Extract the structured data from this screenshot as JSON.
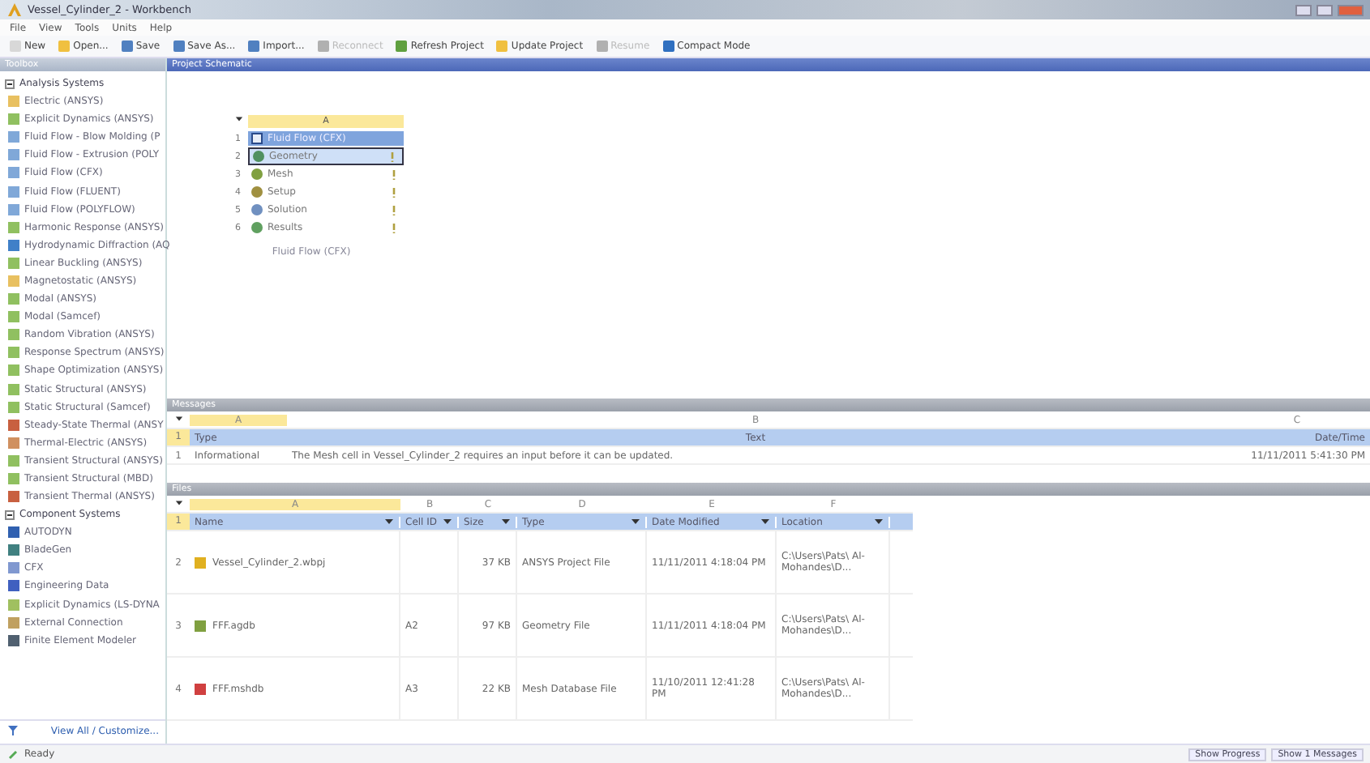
{
  "window": {
    "title": "Vessel_Cylinder_2 - Workbench"
  },
  "menu": [
    "File",
    "View",
    "Tools",
    "Units",
    "Help"
  ],
  "toolbar": [
    {
      "label": "New",
      "disabled": false,
      "color": "#d8d8d8"
    },
    {
      "label": "Open...",
      "disabled": false,
      "color": "#f0c040"
    },
    {
      "label": "Save",
      "disabled": false,
      "color": "#5080c0"
    },
    {
      "label": "Save As...",
      "disabled": false,
      "color": "#5080c0"
    },
    {
      "label": "Import...",
      "disabled": false,
      "color": "#5080c0"
    },
    {
      "label": "Reconnect",
      "disabled": true,
      "color": "#b0b0b0"
    },
    {
      "label": "Refresh Project",
      "disabled": false,
      "color": "#60a040"
    },
    {
      "label": "Update Project",
      "disabled": false,
      "color": "#f0c040"
    },
    {
      "label": "Resume",
      "disabled": true,
      "color": "#b0b0b0"
    },
    {
      "label": "Compact Mode",
      "disabled": false,
      "color": "#3070c0"
    }
  ],
  "toolbox": {
    "title": "Toolbox",
    "footer": "View All / Customize...",
    "groups": [
      {
        "title": "Analysis Systems",
        "expanded": true,
        "items": [
          {
            "label": "Electric (ANSYS)",
            "color": "#e8c060"
          },
          {
            "label": "Explicit Dynamics (ANSYS)",
            "color": "#90c060"
          },
          {
            "label": "Fluid Flow - Blow Molding (P",
            "color": "#80a8d8"
          },
          {
            "label": "Fluid Flow - Extrusion (POLY",
            "color": "#80a8d8"
          },
          {
            "label": "Fluid Flow (CFX)",
            "color": "#80a8d8"
          },
          {
            "label": "Fluid Flow (FLUENT)",
            "color": "#80a8d8"
          },
          {
            "label": "Fluid Flow (POLYFLOW)",
            "color": "#80a8d8"
          },
          {
            "label": "Harmonic Response (ANSYS)",
            "color": "#90c060"
          },
          {
            "label": "Hydrodynamic Diffraction (AQ",
            "color": "#4080c8"
          },
          {
            "label": "Linear Buckling (ANSYS)",
            "color": "#90c060"
          },
          {
            "label": "Magnetostatic (ANSYS)",
            "color": "#e8c060"
          },
          {
            "label": "Modal (ANSYS)",
            "color": "#90c060"
          },
          {
            "label": "Modal (Samcef)",
            "color": "#90c060"
          },
          {
            "label": "Random Vibration (ANSYS)",
            "color": "#90c060"
          },
          {
            "label": "Response Spectrum (ANSYS)",
            "color": "#90c060"
          },
          {
            "label": "Shape Optimization (ANSYS)",
            "color": "#90c060"
          },
          {
            "label": "Static Structural (ANSYS)",
            "color": "#90c060"
          },
          {
            "label": "Static Structural (Samcef)",
            "color": "#90c060"
          },
          {
            "label": "Steady-State Thermal (ANSY",
            "color": "#c86040"
          },
          {
            "label": "Thermal-Electric (ANSYS)",
            "color": "#d09060"
          },
          {
            "label": "Transient Structural (ANSYS)",
            "color": "#90c060"
          },
          {
            "label": "Transient Structural (MBD)",
            "color": "#90c060"
          },
          {
            "label": "Transient Thermal (ANSYS)",
            "color": "#c86040"
          }
        ]
      },
      {
        "title": "Component Systems",
        "expanded": true,
        "items": [
          {
            "label": "AUTODYN",
            "color": "#3060b0"
          },
          {
            "label": "BladeGen",
            "color": "#408080"
          },
          {
            "label": "CFX",
            "color": "#8098d0"
          },
          {
            "label": "Engineering Data",
            "color": "#4060c0"
          },
          {
            "label": "Explicit Dynamics (LS-DYNA",
            "color": "#a0c060"
          },
          {
            "label": "External Connection",
            "color": "#c0a060"
          },
          {
            "label": "Finite Element Modeler",
            "color": "#506070"
          }
        ]
      }
    ]
  },
  "schematic": {
    "title": "Project Schematic",
    "system": {
      "column": "A",
      "caption": "Fluid Flow (CFX)",
      "cells": [
        {
          "number": "1",
          "label": "Fluid Flow (CFX)",
          "kind": "header",
          "color": "#e8eef8"
        },
        {
          "number": "2",
          "label": "Geometry",
          "kind": "cell",
          "selected": true,
          "color": "#509060"
        },
        {
          "number": "3",
          "label": "Mesh",
          "kind": "cell",
          "selected": false,
          "color": "#80a040"
        },
        {
          "number": "4",
          "label": "Setup",
          "kind": "cell",
          "selected": false,
          "color": "#a09040"
        },
        {
          "number": "5",
          "label": "Solution",
          "kind": "cell",
          "selected": false,
          "color": "#7090c0"
        },
        {
          "number": "6",
          "label": "Results",
          "kind": "cell",
          "selected": false,
          "color": "#60a060"
        }
      ]
    }
  },
  "messages": {
    "title": "Messages",
    "header_number": "1",
    "letters": [
      "A",
      "B",
      "C"
    ],
    "columns": [
      "Type",
      "Text",
      "Date/Time"
    ],
    "rows": [
      {
        "number": "1",
        "cells": [
          "Informational",
          "The Mesh cell in Vessel_Cylinder_2 requires an input before it can be updated.",
          "11/11/2011 5:41:30 PM"
        ]
      }
    ]
  },
  "files": {
    "title": "Files",
    "header_number": "1",
    "letters": [
      "A",
      "B",
      "C",
      "D",
      "E",
      "F"
    ],
    "columns": [
      "Name",
      "Cell ID",
      "Size",
      "Type",
      "Date Modified",
      "Location"
    ],
    "rows": [
      {
        "number": "2",
        "color": "#e0b020",
        "cells": [
          "Vessel_Cylinder_2.wbpj",
          "",
          "37 KB",
          "ANSYS Project File",
          "11/11/2011 4:18:04 PM",
          "C:\\Users\\Pats\\ Al-Mohandes\\D..."
        ]
      },
      {
        "number": "3",
        "color": "#80a040",
        "cells": [
          "FFF.agdb",
          "A2",
          "97 KB",
          "Geometry File",
          "11/11/2011 4:18:04 PM",
          "C:\\Users\\Pats\\ Al-Mohandes\\D..."
        ]
      },
      {
        "number": "4",
        "color": "#d04040",
        "cells": [
          "FFF.mshdb",
          "A3",
          "22 KB",
          "Mesh Database File",
          "11/10/2011 12:41:28 PM",
          "C:\\Users\\Pats\\ Al-Mohandes\\D..."
        ]
      }
    ]
  },
  "status_bar": {
    "text": "Ready",
    "buttons": [
      "Show Progress",
      "Show 1 Messages"
    ]
  }
}
